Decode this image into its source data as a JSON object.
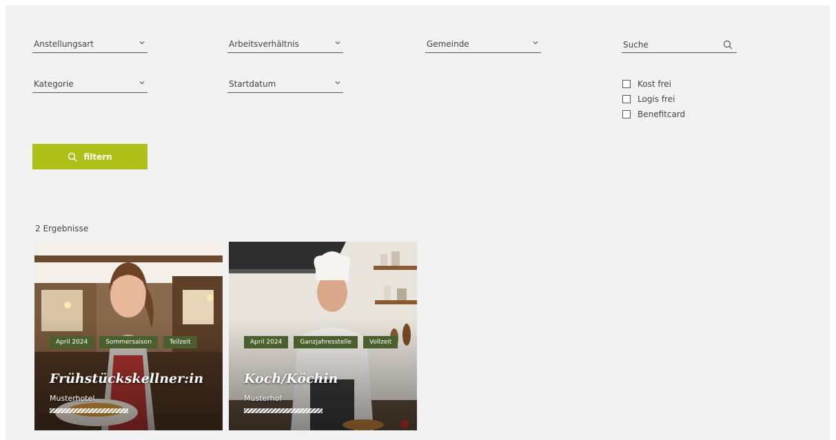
{
  "filters": {
    "anstellungsart": "Anstellungsart",
    "arbeitsverhaeltnis": "Arbeitsverhältnis",
    "gemeinde": "Gemeinde",
    "kategorie": "Kategorie",
    "startdatum": "Startdatum",
    "search_placeholder": "Suche",
    "checkboxes": [
      "Kost frei",
      "Logis frei",
      "Benefitcard"
    ],
    "filter_button": "filtern"
  },
  "results": {
    "count_label": "2 Ergebnisse",
    "cards": [
      {
        "tags": [
          "April 2024",
          "Sommersaison",
          "Teilzeit"
        ],
        "title": "Frühstückskellner:in",
        "company": "Musterhotel"
      },
      {
        "tags": [
          "April 2024",
          "Ganzjahresstelle",
          "Vollzeit"
        ],
        "title": "Koch/Köchin",
        "company": "Musterhof"
      }
    ]
  },
  "colors": {
    "accent": "#aebf17",
    "tag_bg": "#4b5f2e",
    "panel_bg": "#f2f2f2"
  }
}
